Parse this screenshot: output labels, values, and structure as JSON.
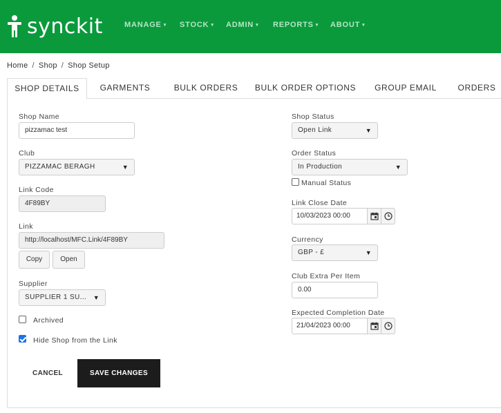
{
  "navbar": {
    "logo_text": "synckit",
    "items": [
      {
        "label": "MANAGE"
      },
      {
        "label": "STOCK"
      },
      {
        "label": "ADMIN"
      },
      {
        "label": "REPORTS"
      },
      {
        "label": "ABOUT"
      }
    ],
    "caret": "▾"
  },
  "breadcrumb": [
    "Home",
    "Shop",
    "Shop Setup"
  ],
  "breadcrumb_sep": "/",
  "tabs": [
    {
      "label": "SHOP DETAILS",
      "active": true
    },
    {
      "label": "GARMENTS"
    },
    {
      "label": "BULK ORDERS"
    },
    {
      "label": "BULK ORDER OPTIONS"
    },
    {
      "label": "GROUP EMAIL"
    },
    {
      "label": "ORDERS"
    }
  ],
  "form": {
    "shop_name": {
      "label": "Shop Name",
      "value": "pizzamac test"
    },
    "club": {
      "label": "Club",
      "value": "PIZZAMAC BERAGH"
    },
    "link_code": {
      "label": "Link Code",
      "value": "4F89BY"
    },
    "link": {
      "label": "Link",
      "value": "http://localhost/MFC.Link/4F89BY"
    },
    "copy_label": "Copy",
    "open_label": "Open",
    "supplier": {
      "label": "Supplier",
      "value": "SUPPLIER 1 SU..."
    },
    "archived": {
      "label": "Archived",
      "checked": false
    },
    "hide_shop": {
      "label": "Hide Shop from the Link",
      "checked": true
    },
    "shop_status": {
      "label": "Shop Status",
      "value": "Open Link"
    },
    "order_status": {
      "label": "Order Status",
      "value": "In Production"
    },
    "manual_status": {
      "label": "Manual Status",
      "checked": false
    },
    "link_close_date": {
      "label": "Link Close Date",
      "value": "10/03/2023 00:00"
    },
    "currency": {
      "label": "Currency",
      "value": "GBP - £"
    },
    "club_extra": {
      "label": "Club Extra Per Item",
      "value": "0.00"
    },
    "expected_completion": {
      "label": "Expected Completion Date",
      "value": "21/04/2023 00:00"
    }
  },
  "actions": {
    "cancel_label": "CANCEL",
    "save_label": "SAVE CHANGES"
  },
  "select_arrow": "▼",
  "colors": {
    "brand": "#0a9a3c",
    "save_button": "#1c1c1c",
    "checkbox_checked": "#1a73e8"
  },
  "icons": [
    "person-logo-icon",
    "calendar-icon",
    "clock-icon",
    "chevron-down-icon"
  ]
}
